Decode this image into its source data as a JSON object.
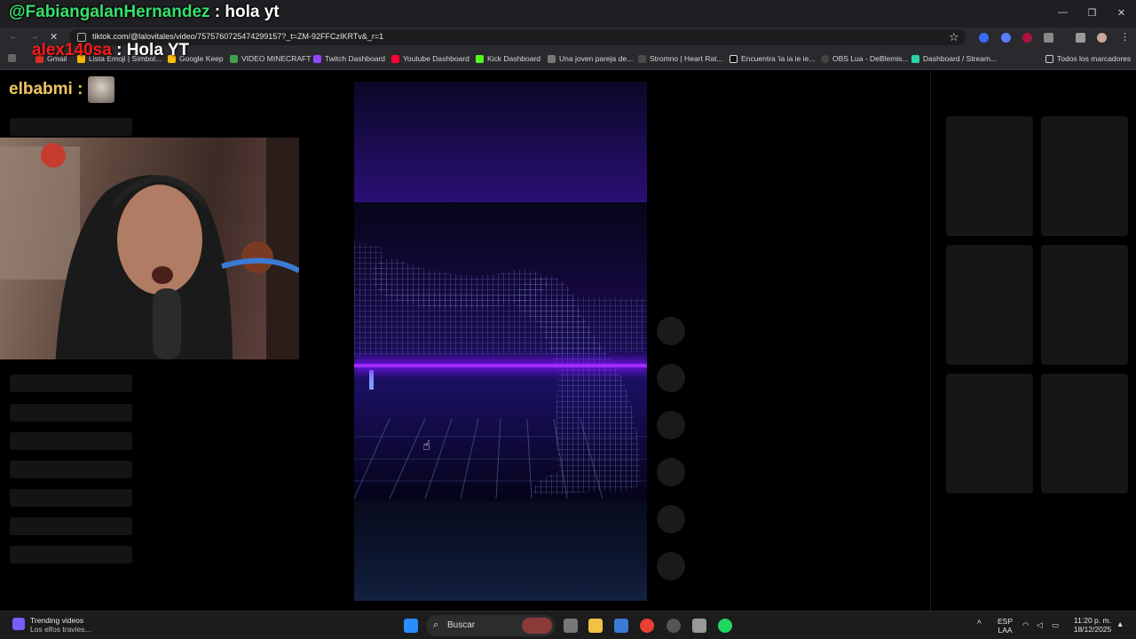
{
  "overlays": {
    "line1_user": "@FabiangalanHernandez",
    "line1_msg": ": hola yt",
    "line2_user": "alex140sa",
    "line2_msg": ": Hola YT",
    "line3_user": "elbabmi :"
  },
  "browser": {
    "url": "tiktok.com/@lalovitales/video/7575760725474299157?_t=ZM-92FFCzIKRTv&_r=1",
    "bookmarks": [
      {
        "label": "Gmail",
        "icon": "gmail-icon"
      },
      {
        "label": "Lista Emoji | Símbol...",
        "icon": "emoji-icon"
      },
      {
        "label": "Google Keep",
        "icon": "keep-icon"
      },
      {
        "label": "VIDEO MINECRAFT",
        "icon": "minecraft-icon"
      },
      {
        "label": "Twitch Dashboard",
        "icon": "twitch-icon"
      },
      {
        "label": "Youtube Dashboard",
        "icon": "youtube-icon"
      },
      {
        "label": "Kick Dashboard",
        "icon": "kick-icon"
      },
      {
        "label": "Una joven pareja de...",
        "icon": "page-icon"
      },
      {
        "label": "Stromno | Heart Rat...",
        "icon": "heart-icon"
      },
      {
        "label": "Encuentra 'ia ia ie ie...",
        "icon": "tiktok-icon"
      },
      {
        "label": "OBS Lua - DeBlemis...",
        "icon": "obs-icon"
      },
      {
        "label": "Dashboard / Stream...",
        "icon": "stream-icon"
      }
    ],
    "all_bookmarks": "Todos los marcadores"
  },
  "taskbar": {
    "news_title": "Trending videos",
    "news_sub": "Los elfos travies...",
    "search_placeholder": "Buscar",
    "lang_top": "ESP",
    "lang_bottom": "LAA",
    "time": "11:20 p. m.",
    "date": "18/12/2025"
  },
  "colors": {
    "overlay_user_green": "#36e06a",
    "overlay_user_red": "#ff1a1a",
    "overlay_user_gold": "#f2c55c",
    "neon_purple": "#a22bff"
  }
}
